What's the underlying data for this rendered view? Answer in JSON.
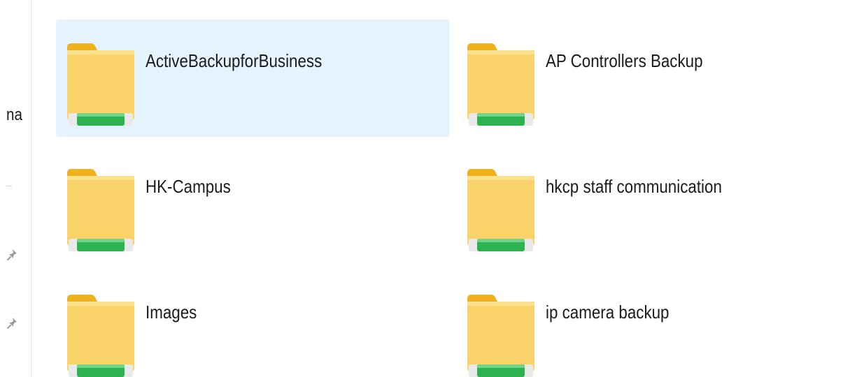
{
  "navigation": {
    "partial_label": "na",
    "pin_icon": "pin-icon"
  },
  "folder_icon": "shared-folder-icon",
  "colors": {
    "selection": "#e5f3fd",
    "folder_body": "#f9d36a",
    "folder_tab": "#f0b11e",
    "share_bar": "#2cb34f"
  },
  "folders": [
    {
      "name": "ActiveBackupforBusiness",
      "selected": true
    },
    {
      "name": "AP Controllers Backup",
      "selected": false
    },
    {
      "name": "HK-Campus",
      "selected": false
    },
    {
      "name": "hkcp staff communication",
      "selected": false
    },
    {
      "name": "Images",
      "selected": false
    },
    {
      "name": "ip camera backup",
      "selected": false
    }
  ]
}
